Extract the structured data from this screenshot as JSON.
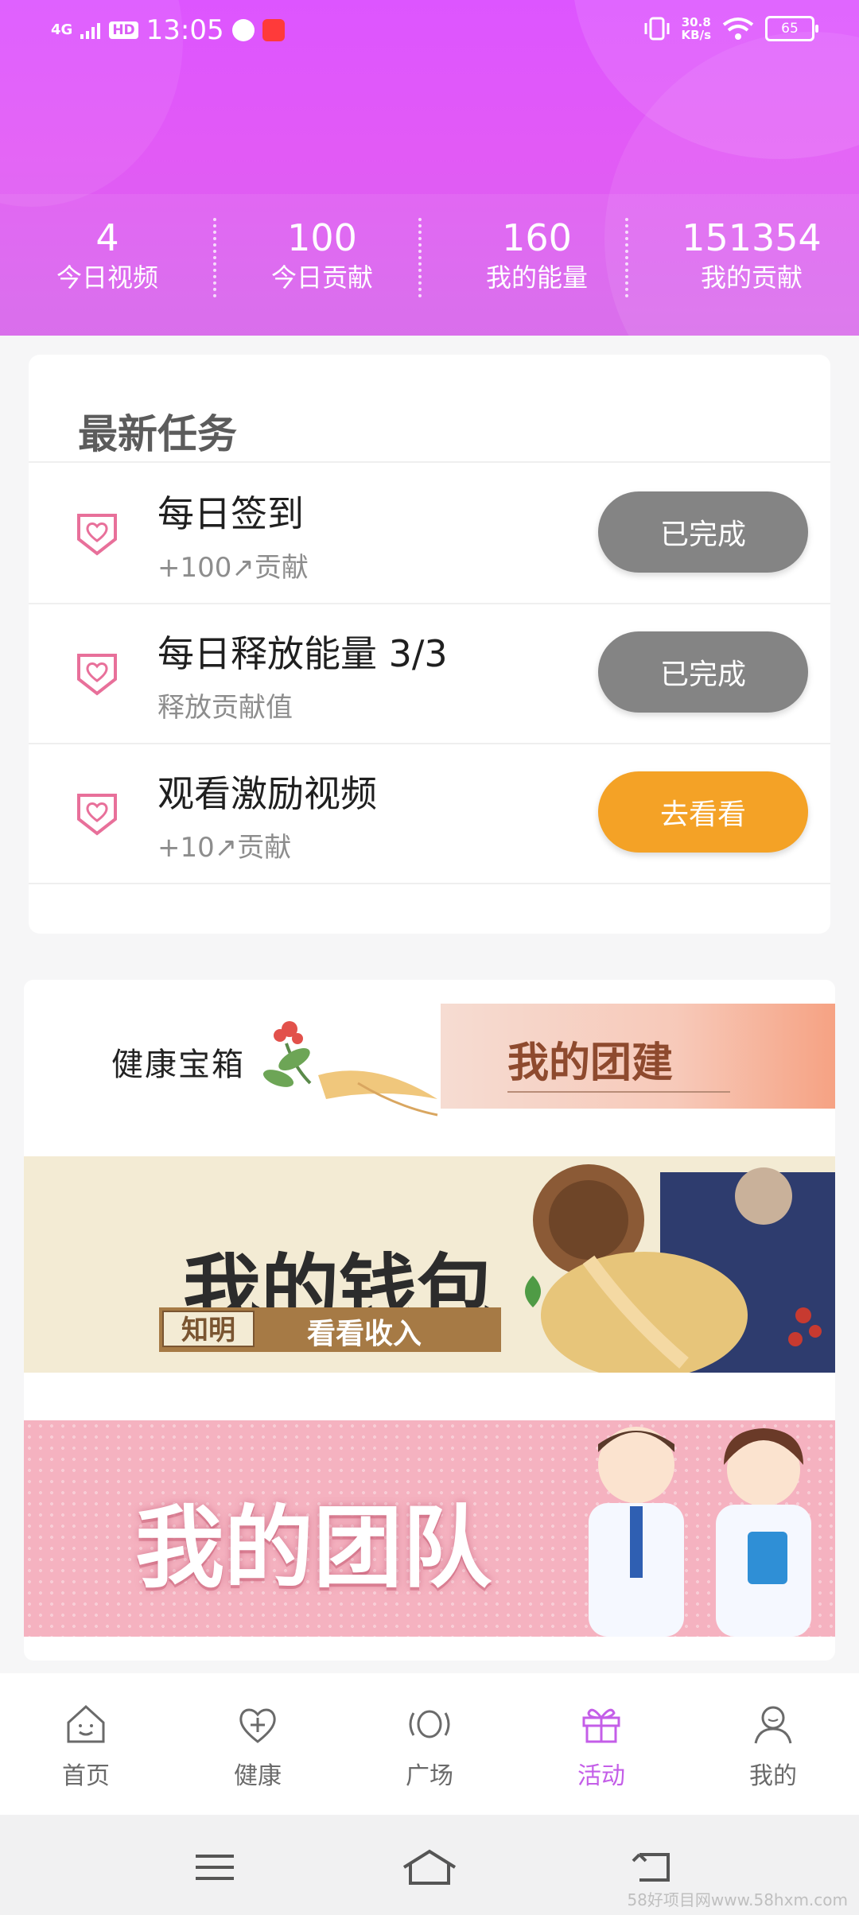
{
  "status_bar": {
    "signal": "4G",
    "hd": "HD",
    "time": "13:05",
    "speed_value": "30.8",
    "speed_unit": "KB/s",
    "battery": "65"
  },
  "stats": [
    {
      "value": "4",
      "label": "今日视频"
    },
    {
      "value": "100",
      "label": "今日贡献"
    },
    {
      "value": "160",
      "label": "我的能量"
    },
    {
      "value": "151354",
      "label": "我的贡献"
    }
  ],
  "tasks": {
    "title": "最新任务",
    "items": [
      {
        "name": "每日签到",
        "sub": "+100↗贡献",
        "button": "已完成"
      },
      {
        "name": "每日释放能量 3/3",
        "sub": "释放贡献值",
        "button": "已完成"
      },
      {
        "name": "观看激励视频",
        "sub": "+10↗贡献",
        "button": "去看看"
      }
    ]
  },
  "banners": {
    "health_box": "健康宝箱",
    "team_build": "我的团建",
    "wallet_title": "我的钱包",
    "wallet_tag": "知明",
    "wallet_action": "看看收入",
    "team": "我的团队"
  },
  "nav": {
    "items": [
      {
        "label": "首页",
        "icon": "home-icon"
      },
      {
        "label": "健康",
        "icon": "health-icon"
      },
      {
        "label": "广场",
        "icon": "square-icon"
      },
      {
        "label": "活动",
        "icon": "gift-icon"
      },
      {
        "label": "我的",
        "icon": "profile-icon"
      }
    ],
    "active_index": 3,
    "active_color": "#c45ee8"
  },
  "watermark": "58好项目网www.58hxm.com",
  "colors": {
    "header": "#dd55ff",
    "done_button": "#848484",
    "go_button": "#f4a226"
  }
}
